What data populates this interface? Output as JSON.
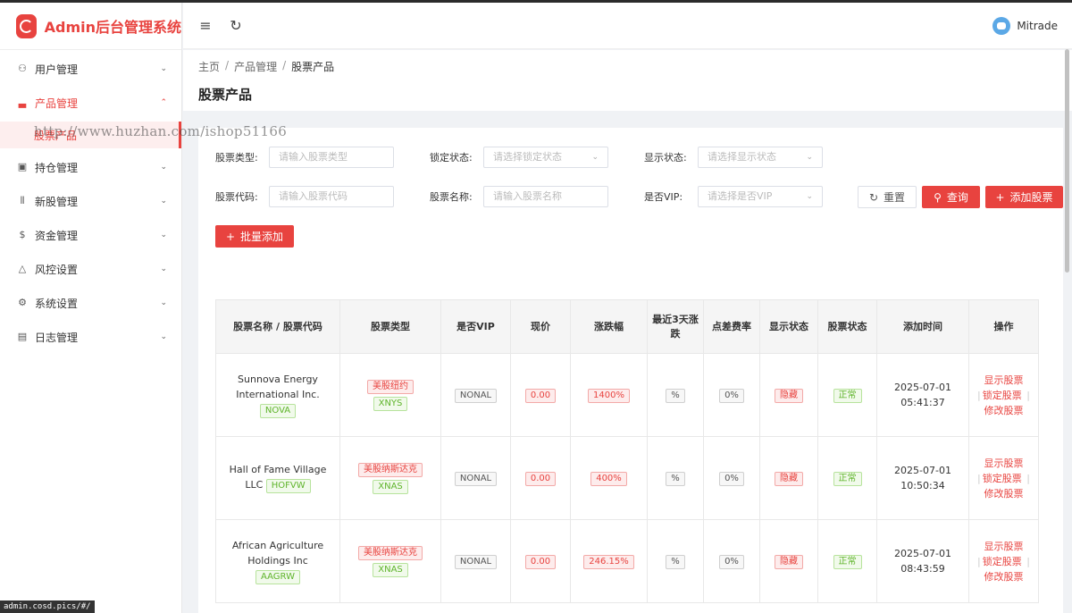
{
  "app": {
    "title": "Admin后台管理系统",
    "user_name": "Mitrade"
  },
  "sidebar": {
    "items": [
      {
        "label": "用户管理",
        "icon": "users-icon",
        "glyph": "⚇"
      },
      {
        "label": "产品管理",
        "icon": "chart-icon",
        "glyph": "▃"
      },
      {
        "label": "持仓管理",
        "icon": "wallet-icon",
        "glyph": "▣"
      },
      {
        "label": "新股管理",
        "icon": "bars-icon",
        "glyph": "⦀"
      },
      {
        "label": "资金管理",
        "icon": "coin-icon",
        "glyph": "$"
      },
      {
        "label": "风控设置",
        "icon": "warning-icon",
        "glyph": "△"
      },
      {
        "label": "系统设置",
        "icon": "gear-icon",
        "glyph": "⚙"
      },
      {
        "label": "日志管理",
        "icon": "log-icon",
        "glyph": "▤"
      }
    ],
    "sub_item": "股票产品"
  },
  "breadcrumb": {
    "home": "主页",
    "section": "产品管理",
    "current": "股票产品"
  },
  "page_title": "股票产品",
  "filters": {
    "stock_type_label": "股票类型:",
    "stock_type_ph": "请输入股票类型",
    "lock_label": "锁定状态:",
    "lock_ph": "请选择锁定状态",
    "display_label": "显示状态:",
    "display_ph": "请选择显示状态",
    "code_label": "股票代码:",
    "code_ph": "请输入股票代码",
    "name_label": "股票名称:",
    "name_ph": "请输入股票名称",
    "vip_label": "是否VIP:",
    "vip_ph": "请选择是否VIP"
  },
  "buttons": {
    "reset": "重置",
    "query": "查询",
    "add": "添加股票",
    "batch_add": "批量添加"
  },
  "table": {
    "headers": [
      "股票名称 / 股票代码",
      "股票类型",
      "是否VIP",
      "现价",
      "涨跌幅",
      "最近3天涨跌",
      "点差费率",
      "显示状态",
      "股票状态",
      "添加时间",
      "操作"
    ],
    "rows": [
      {
        "name": "Sunnova Energy International Inc.",
        "code": "NOVA",
        "market": "美股纽约",
        "exchange": "XNYS",
        "vip": "NONAL",
        "price": "0.00",
        "change": "1400%",
        "three_day": "%",
        "spread": "0%",
        "display": "隐藏",
        "status": "正常",
        "date": "2025-07-01",
        "time": "05:41:37"
      },
      {
        "name": "Hall of Fame Village LLC",
        "code": "HOFVW",
        "market": "美股纳斯达克",
        "exchange": "XNAS",
        "vip": "NONAL",
        "price": "0.00",
        "change": "400%",
        "three_day": "%",
        "spread": "0%",
        "display": "隐藏",
        "status": "正常",
        "date": "2025-07-01",
        "time": "10:50:34"
      },
      {
        "name": "African Agriculture Holdings Inc",
        "code": "AAGRW",
        "market": "美股纳斯达克",
        "exchange": "XNAS",
        "vip": "NONAL",
        "price": "0.00",
        "change": "246.15%",
        "three_day": "%",
        "spread": "0%",
        "display": "隐藏",
        "status": "正常",
        "date": "2025-07-01",
        "time": "08:43:59"
      }
    ],
    "ops": {
      "show": "显示股票",
      "lock": "锁定股票",
      "edit": "修改股票"
    }
  },
  "status_url": "admin.cosd.pics/#/",
  "watermark": "http://www.huzhan.com/ishop51166",
  "colors": {
    "accent": "#e8433f",
    "success": "#5fb42b"
  }
}
